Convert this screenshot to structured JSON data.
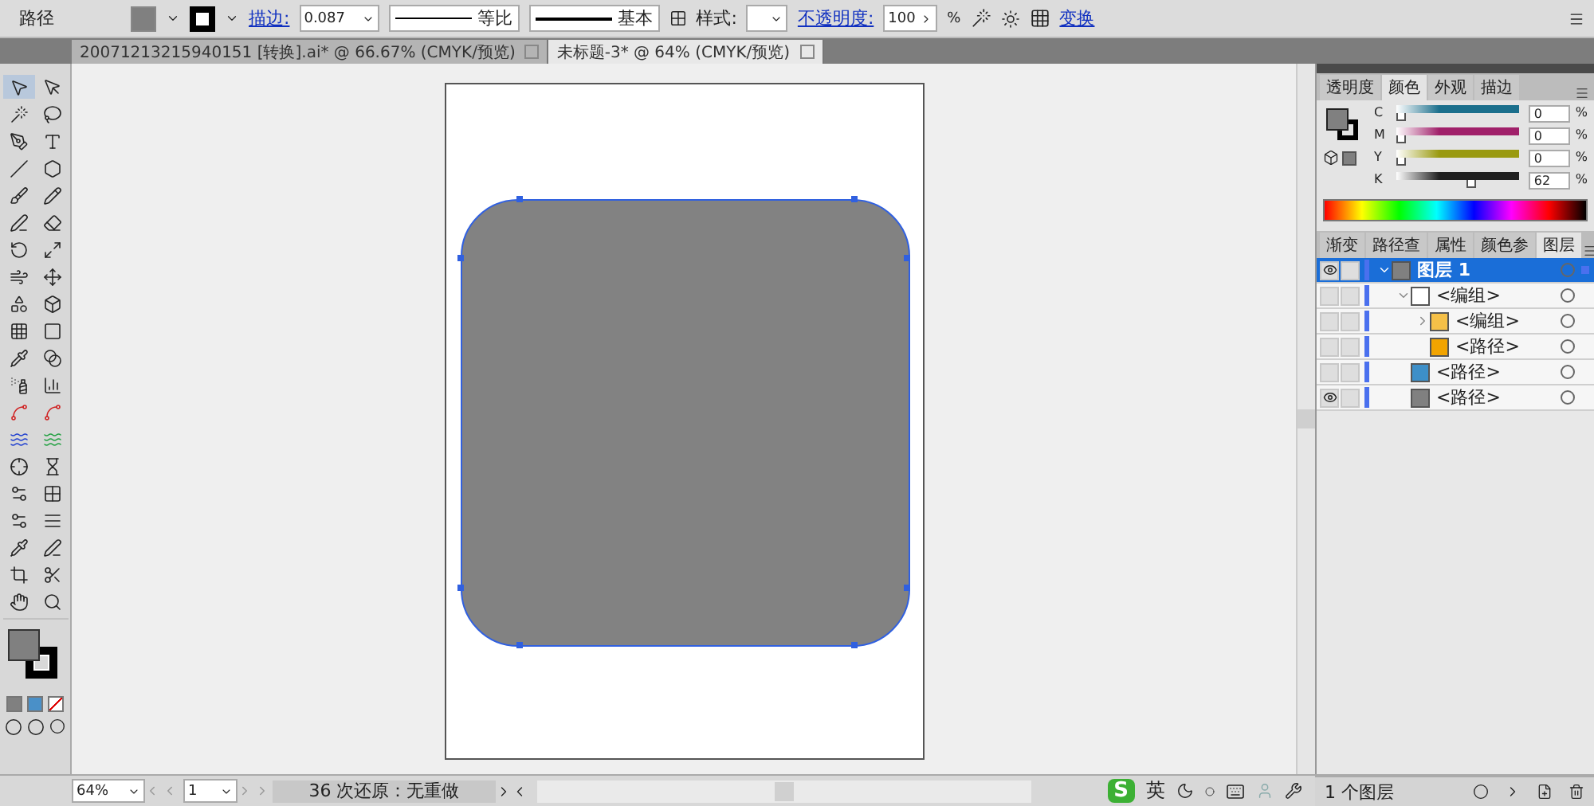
{
  "control_bar": {
    "object_type": "路径",
    "stroke_link": "描边:",
    "stroke_weight": "0.087",
    "profile": "等比",
    "brush": "基本",
    "style_label": "样式:",
    "opacity_link": "不透明度:",
    "opacity": "100",
    "percent": "%",
    "transform_link": "变换"
  },
  "document_tabs": [
    {
      "label": "20071213215940151  [转换].ai* @ 66.67% (CMYK/预览)",
      "selected": false
    },
    {
      "label": "未标题-3* @ 64% (CMYK/预览)",
      "selected": true
    }
  ],
  "color_panel": {
    "tabs": [
      {
        "label": "透明度",
        "selected": false
      },
      {
        "label": "颜色",
        "selected": true
      },
      {
        "label": "外观",
        "selected": false
      },
      {
        "label": "描边",
        "selected": false
      }
    ],
    "channels": [
      {
        "name": "C",
        "color": "#1b6f8c",
        "level": 0,
        "value": "0",
        "unit": "%"
      },
      {
        "name": "M",
        "color": "#a0206a",
        "level": 0,
        "value": "0",
        "unit": "%"
      },
      {
        "name": "Y",
        "color": "#9a9a10",
        "level": 0,
        "value": "0",
        "unit": "%"
      },
      {
        "name": "K",
        "color": "#202020",
        "level": 0.62,
        "value": "62",
        "unit": "%"
      }
    ]
  },
  "layers_panel": {
    "tabs": [
      {
        "label": "渐变",
        "selected": false
      },
      {
        "label": "路径查",
        "selected": false
      },
      {
        "label": "属性",
        "selected": false
      },
      {
        "label": "颜色参",
        "selected": false
      },
      {
        "label": "图层",
        "selected": true
      }
    ],
    "layers": [
      {
        "name": "图层 1",
        "color": "#808080",
        "visible": true,
        "selected": true,
        "expanded": true,
        "children": [
          {
            "name": "<编组>",
            "color": "#ffffff",
            "visible": false,
            "selected": false,
            "expanded": true,
            "children": [
              {
                "name": "<编组>",
                "color": "#f5c048",
                "visible": false,
                "selected": false,
                "expanded": false
              },
              {
                "name": "<路径>",
                "color": "#f2a400",
                "visible": false,
                "selected": false
              }
            ]
          },
          {
            "name": "<路径>",
            "color": "#3d8fc8",
            "visible": false,
            "selected": false
          },
          {
            "name": "<路径>",
            "color": "#808080",
            "visible": true,
            "selected": false
          }
        ]
      }
    ],
    "footer": "1 个图层"
  },
  "status_bar": {
    "zoom": "64%",
    "page": "1",
    "history": "36 次还原：无重做",
    "ime_logo": "S",
    "ime_language": "英"
  }
}
